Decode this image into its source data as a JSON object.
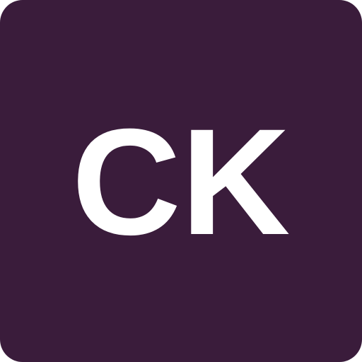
{
  "avatar": {
    "initials": "CK",
    "background_color": "#3a1c3b",
    "text_color": "#ffffff"
  }
}
